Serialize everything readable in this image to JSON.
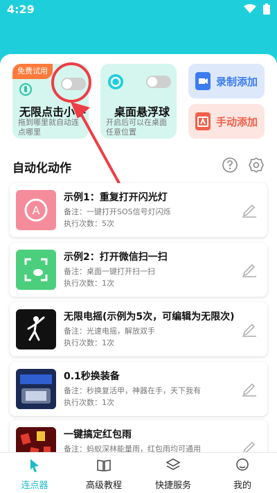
{
  "status_bar": {
    "time": "4:29"
  },
  "cards": {
    "clicker": {
      "badge": "免费试用",
      "title": "无限点击小手",
      "desc": "拖到哪里就自动连点哪里"
    },
    "float_ball": {
      "title": "桌面悬浮球",
      "desc": "开启后可以在桌面任意位置"
    }
  },
  "actions": {
    "record": "录制添加",
    "manual": "手动添加"
  },
  "section": {
    "title": "自动化动作"
  },
  "items": [
    {
      "name": "示例1：重复打开闪光灯",
      "note": "备注：一键打开SOS信号灯闪烁",
      "count": "执行次数：5次"
    },
    {
      "name": "示例2：打开微信扫一扫",
      "note": "备注：桌面一键打开扫一扫",
      "count": "执行次数：1次"
    },
    {
      "name": "无限电摇(示例为5次，可编辑为无限次)",
      "note": "备注：光速电摇，解放双手",
      "count": "执行次数：1次"
    },
    {
      "name": "0.1秒换装备",
      "note": "备注：秒换复活甲，神器在手，天下我有",
      "count": "执行次数：1次"
    },
    {
      "name": "一键搞定红包雨",
      "note": "备注：蚂蚁深林能量雨，红包雨均可通用",
      "count": ""
    }
  ],
  "tabs": [
    {
      "label": "连点器"
    },
    {
      "label": "高级教程"
    },
    {
      "label": "快捷服务"
    },
    {
      "label": "我的"
    }
  ],
  "colors": {
    "accent": "#1ecfdb",
    "mark_red": "#ee3d46",
    "trial_orange": "#ff7a3a"
  }
}
